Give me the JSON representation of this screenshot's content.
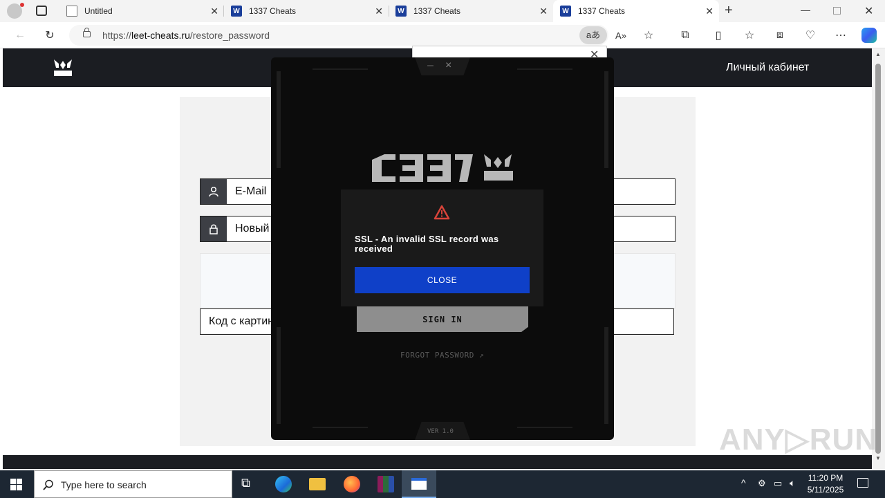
{
  "browser": {
    "tabs": [
      {
        "title": "Untitled",
        "icon": "page-icon"
      },
      {
        "title": "1337 Cheats",
        "icon": "site-logo-icon"
      },
      {
        "title": "1337 Cheats",
        "icon": "site-logo-icon"
      },
      {
        "title": "1337 Cheats",
        "icon": "site-logo-icon",
        "active": true
      }
    ],
    "url_prefix": "https://",
    "url_domain": "leet-cheats.ru",
    "url_path": "/restore_password"
  },
  "site": {
    "cabinet_label": "Личный кабинет",
    "email_label": "E-Mail",
    "new_password_label": "Новый",
    "captcha_label": "Код с картин"
  },
  "app": {
    "min_label": "–",
    "close_label": "×",
    "signin_label": "SIGN IN",
    "forgot_label": "FORGOT PASSWORD ↗",
    "version": "VER 1.0"
  },
  "error": {
    "message": "SSL - An invalid SSL record was received",
    "close_label": "CLOSE"
  },
  "watermark": "ANY▷RUN",
  "taskbar": {
    "search_placeholder": "Type here to search",
    "time": "11:20 PM",
    "date": "5/11/2025"
  },
  "colors": {
    "accent_blue": "#0f40c8",
    "site_dark": "#1b1d22",
    "warning_red": "#d9443a"
  }
}
